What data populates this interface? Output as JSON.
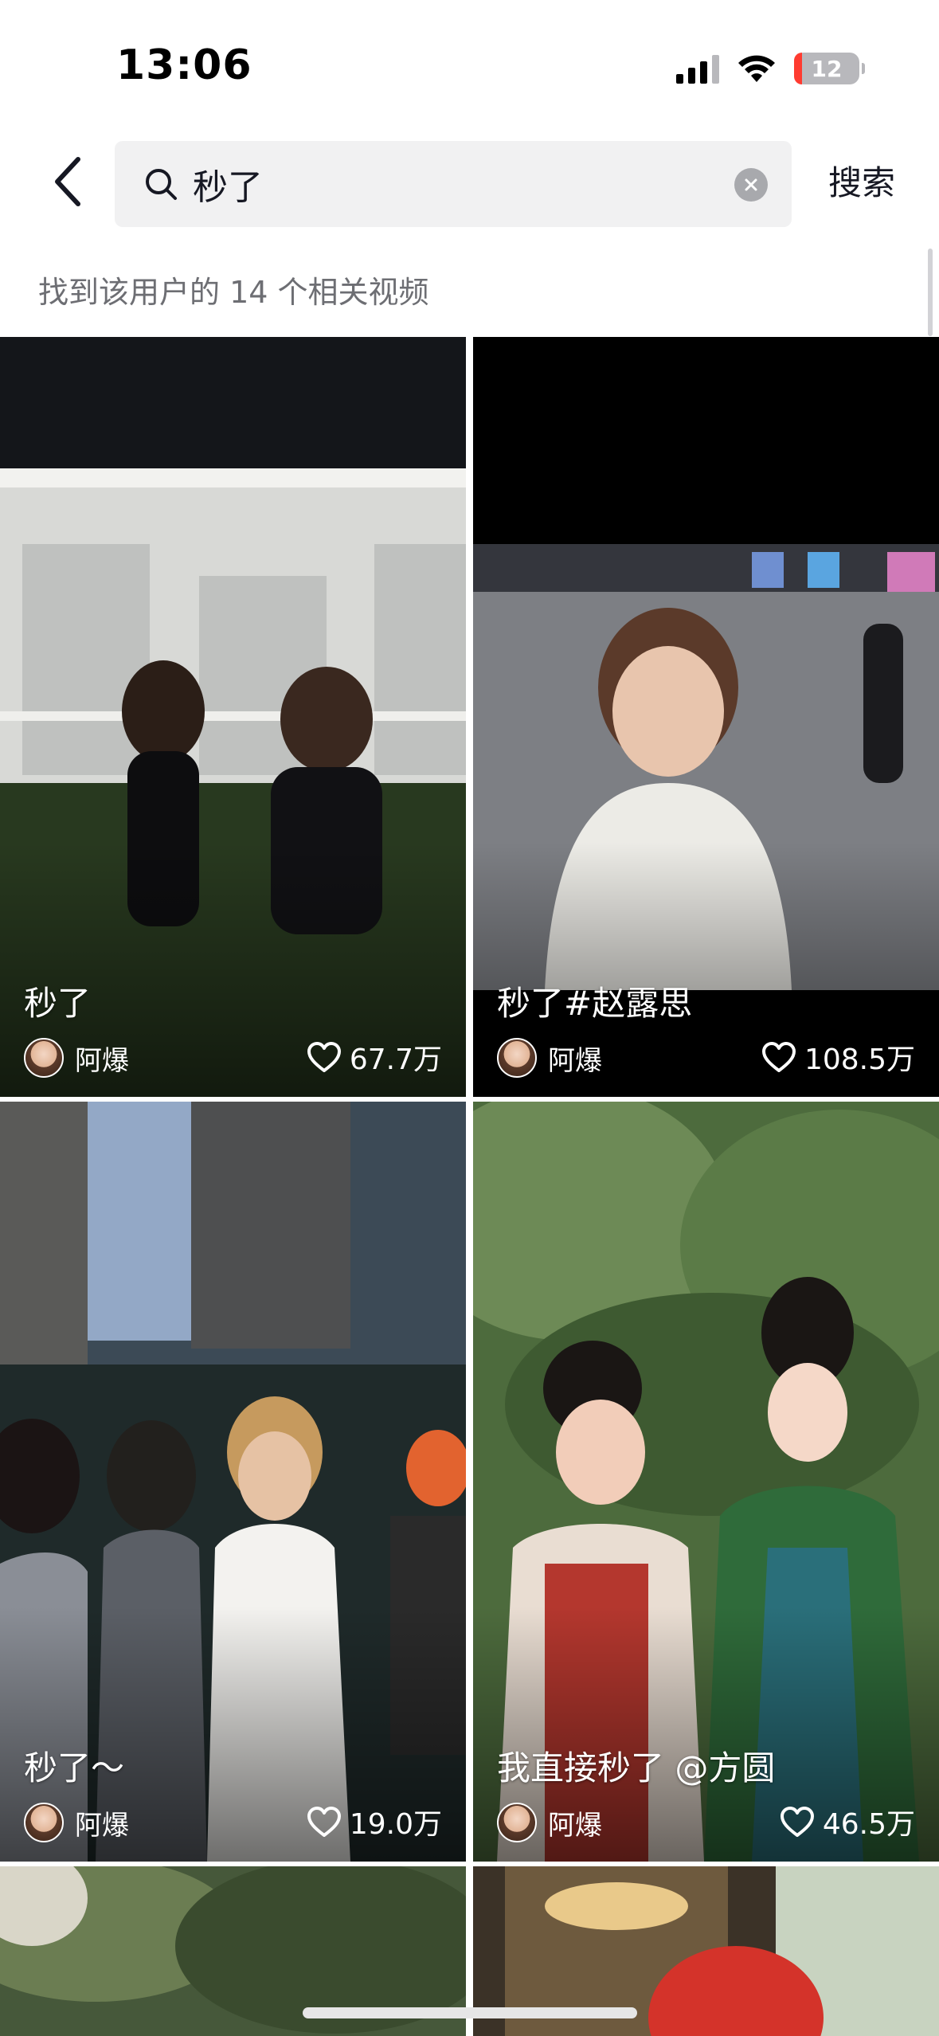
{
  "status_bar": {
    "time": "13:06",
    "battery": "12"
  },
  "search": {
    "query": "秒了",
    "button_label": "搜索"
  },
  "result_count_text": "找到该用户的 14 个相关视频",
  "videos": [
    {
      "title": "秒了",
      "author": "阿爆",
      "likes": "67.7万"
    },
    {
      "title": "秒了#赵露思",
      "author": "阿爆",
      "likes": "108.5万"
    },
    {
      "title": "秒了～",
      "author": "阿爆",
      "likes": "19.0万"
    },
    {
      "title": "我直接秒了 @方圆",
      "author": "阿爆",
      "likes": "46.5万"
    }
  ]
}
